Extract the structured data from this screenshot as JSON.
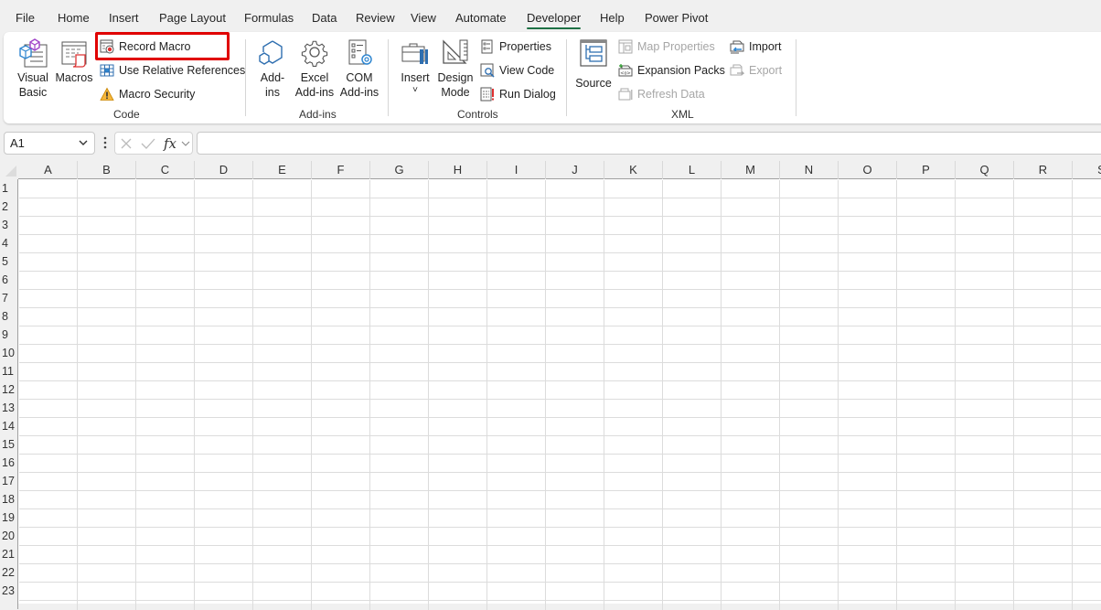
{
  "menu": {
    "tabs": [
      {
        "label": "File",
        "active": false
      },
      {
        "label": "Home",
        "active": false
      },
      {
        "label": "Insert",
        "active": false
      },
      {
        "label": "Page Layout",
        "active": false
      },
      {
        "label": "Formulas",
        "active": false
      },
      {
        "label": "Data",
        "active": false
      },
      {
        "label": "Review",
        "active": false
      },
      {
        "label": "View",
        "active": false
      },
      {
        "label": "Automate",
        "active": false
      },
      {
        "label": "Developer",
        "active": true
      },
      {
        "label": "Help",
        "active": false
      },
      {
        "label": "Power Pivot",
        "active": false
      }
    ]
  },
  "ribbon": {
    "code": {
      "label": "Code",
      "visual_basic": [
        "Visual",
        "Basic"
      ],
      "macros": "Macros",
      "record_macro": "Record Macro",
      "use_relative_references": "Use Relative References",
      "macro_security": "Macro Security"
    },
    "addins": {
      "label": "Add-ins",
      "addins": [
        "Add-",
        "ins"
      ],
      "excel_addins": [
        "Excel",
        "Add-ins"
      ],
      "com_addins": [
        "COM",
        "Add-ins"
      ]
    },
    "controls": {
      "label": "Controls",
      "insert": "Insert",
      "insert_chevron": "˅",
      "design_mode": [
        "Design",
        "Mode"
      ],
      "properties": "Properties",
      "view_code": "View Code",
      "run_dialog": "Run Dialog"
    },
    "xml": {
      "label": "XML",
      "source": "Source",
      "map_properties": "Map Properties",
      "expansion_packs": "Expansion Packs",
      "refresh_data": "Refresh Data",
      "import": "Import",
      "export": "Export"
    }
  },
  "formula_bar": {
    "name_box": "A1",
    "formula": ""
  },
  "sheet": {
    "columns": [
      "A",
      "B",
      "C",
      "D",
      "E",
      "F",
      "G",
      "H",
      "I",
      "J",
      "K",
      "L",
      "M",
      "N",
      "O",
      "P",
      "Q",
      "R",
      "S"
    ],
    "rows": [
      "1",
      "2",
      "3",
      "4",
      "5",
      "6",
      "7",
      "8",
      "9",
      "10",
      "11",
      "12",
      "13",
      "14",
      "15",
      "16",
      "17",
      "18",
      "19",
      "20",
      "21",
      "22",
      "23"
    ]
  },
  "colors": {
    "accent": "#1e7145",
    "highlight": "#e00000",
    "disabled_text": "#a6a6a6"
  }
}
